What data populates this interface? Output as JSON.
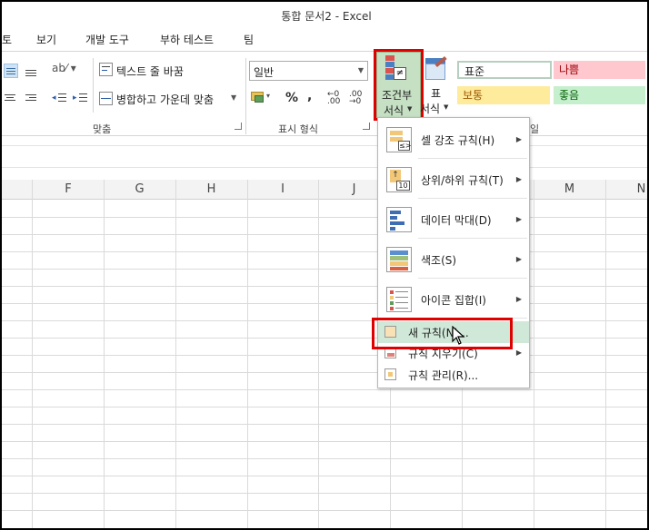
{
  "window": {
    "title": "통합 문서2 - Excel"
  },
  "tabs": [
    {
      "label": "토"
    },
    {
      "label": "보기"
    },
    {
      "label": "개발 도구"
    },
    {
      "label": "부하 테스트"
    },
    {
      "label": "팀"
    }
  ],
  "alignment": {
    "wrap_text": "텍스트 줄 바꿈",
    "merge_center": "병합하고 가운데 맞춤",
    "group_label": "맞춤"
  },
  "number": {
    "format_value": "일반",
    "percent": "%",
    "comma": ",",
    "group_label": "표시 형식"
  },
  "styles": {
    "conditional_format_line1": "조건부",
    "conditional_format_line2": "서식",
    "table_format_line1": "표",
    "table_format_line2": "서식",
    "cell_styles": [
      {
        "label": "표준",
        "color": "#ffffff"
      },
      {
        "label": "나쁨",
        "color": "#ffc7ce"
      },
      {
        "label": "보통",
        "color": "#ffeb9c"
      },
      {
        "label": "좋음",
        "color": "#c6efce"
      }
    ],
    "group_label_partial": "일"
  },
  "columns": [
    "F",
    "G",
    "H",
    "I",
    "J",
    "M",
    "N"
  ],
  "menu": {
    "items": [
      {
        "label": "셀 강조 규칙(H)",
        "has_submenu": true
      },
      {
        "label": "상위/하위 규칙(T)",
        "has_submenu": true
      },
      {
        "label": "데이터 막대(D)",
        "has_submenu": true
      },
      {
        "label": "색조(S)",
        "has_submenu": true
      },
      {
        "label": "아이콘 집합(I)",
        "has_submenu": true
      }
    ],
    "small_items": [
      {
        "label": "새 규칙(N)...",
        "highlighted": true
      },
      {
        "label": "규칙 지우기(C)",
        "has_submenu": true
      },
      {
        "label": "규칙 관리(R)..."
      }
    ]
  },
  "colors": {
    "highlight_red": "#e00000",
    "menu_hover": "#cfe8d8",
    "selected_button": "#c6e0c4"
  }
}
